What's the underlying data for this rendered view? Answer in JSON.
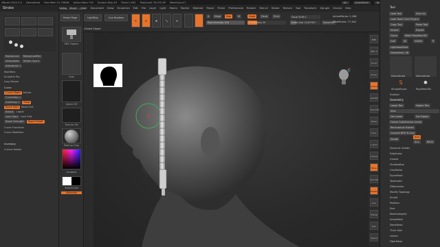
{
  "titlebar": {
    "app": "ZBrush 2022.0.5",
    "doc": "DemoHead",
    "free_mem": "Free Mem 21.758GB",
    "active_mem": "Active Mem 719",
    "scratch": "Scratch Disk 49",
    "timer": "Timer 0.001",
    "polycount": "PolyCount 76.072 KP",
    "meshcount": "MeshCount 2",
    "ac": "AC",
    "quicksave": "QuickSave",
    "seethrough": "See-through 0",
    "menus": "Menus",
    "default_script": "DefaultZScript"
  },
  "menubar": {
    "panel_title": "Stroke",
    "items": [
      "Alpha",
      "Brush",
      "Color",
      "Document",
      "Draw",
      "Dynamics",
      "Edit",
      "File",
      "Layer",
      "Light",
      "Macro",
      "Marker",
      "Material",
      "Movie",
      "Picker",
      "Preferences",
      "Render",
      "Stencil",
      "Stroke",
      "Texture",
      "Tool",
      "Transform",
      "Zplugin",
      "Zscript",
      "Help"
    ]
  },
  "leftpanel": {
    "replay_last": "ReplayLast",
    "replay_last_rel": "ReplayLastRel",
    "interpolate": "Interpolate",
    "stroke_count": "Stroke Count",
    "adjust_last": "AdjustLast 1",
    "modifiers": "Modifiers",
    "sculptris_pro": "Sculptris Pro",
    "lazy_mouse": "Lazy Mouse",
    "curve": "Curve",
    "curve_mode": "Curve Mode",
    "as_line": "AsLine",
    "curve_step": "CurveStep 1",
    "sub_steps": "SubSteps 1",
    "snap": "Snap",
    "bend_start": "Bend Start",
    "bend_end": "Bend End",
    "elastic": "Elastic",
    "liquid": "Liquid",
    "lock_start": "Lock Start",
    "lock_end": "Lock End",
    "repel_strength": "Repel Strength",
    "repel_falloff": "Repel Falloff",
    "curve_functions": "Curve Functions",
    "curve_modifiers": "Curve Modifiers",
    "inventory": "Inventory",
    "curves_helper": "Curves Helper"
  },
  "thumbcol": {
    "home_page": "Home Page",
    "zipper_label": "ZBS Zippers",
    "stroke_label": "Dots",
    "alpha_label": "Alpha Off",
    "texture_label": "Texture Off",
    "matcap_label": "MatCap Gray",
    "gradient": "Gradient",
    "switch_color": "SwitchColor",
    "alternate": "Alternate"
  },
  "toptool": {
    "home_page": "Home Page",
    "lightbox": "LightBox",
    "live_boolean": "Live Boolean",
    "closed_zipper": "Closed Zipper",
    "edit": "Edit",
    "draw": "Draw",
    "move": "Move",
    "scale": "Scale",
    "rotate": "Rotate",
    "a_label": "A",
    "mrgb": "Mrgb",
    "rgb": "Rgb",
    "m": "M",
    "zadd": "Zadd",
    "zsub": "Zsub",
    "zcut": "Zcut",
    "rgb_intensity": "Rgb Intensity 100",
    "z_intensity": "Z Intensity 25",
    "focal_shift": "Focal Shift 0",
    "draw_size": "Draw Size 14.87927",
    "dynamic": "Dynamic",
    "active_points": "ActivePoints: 2,168",
    "total_points": "TotalPoints: 77,342",
    "coords": "0.255 -0.315 -0.071"
  },
  "rightpanel": {
    "title": "Tool",
    "load_tool": "Load Tool",
    "save_as": "Save As",
    "load_tools_project": "Load Tools From Project",
    "copy_tool": "Copy Tool",
    "paste_tool": "Paste Tool",
    "import": "Import",
    "export": "Export",
    "clone": "Clone",
    "make_polymesh": "Make PolyMesh3D",
    "goz": "GoZ",
    "all": "All",
    "visible": "Visible",
    "r": "R",
    "lightbox_tools": "Lightbox▸Tools",
    "demohead": "DemoHead. 48",
    "tool1": "DemoHead",
    "tool2": "DemoHead",
    "tool3": "SimpleBrush",
    "tool4": "PolyMesh3D",
    "subtool": "Subtool",
    "geometry": "Geometry",
    "lower_res": "Lower Res",
    "higher_res": "Higher Res",
    "sdiv": "SDiv",
    "del_lower": "Del Lower",
    "del_higher": "Del Higher",
    "freeze_subdiv": "Freeze SubDivision Levels",
    "reconstruct_subdiv": "Reconstruct Subdiv",
    "convert_bpr": "Convert BPR To Geo",
    "divide": "Divide",
    "smt": "Smt",
    "suv": "Suv",
    "reuv": "ReUV",
    "dynamic_subdiv": "Dynamic Subdiv",
    "edgeloop": "EdgeLoop",
    "crease": "Crease",
    "shadowbox": "ShadowBox",
    "claypolish": "ClayPolish",
    "dynamesh": "DynaMesh",
    "tessimate": "Tessimate",
    "zremesher": "ZRemesher",
    "modify_topology": "Modify Topology",
    "sculpt": "Sculpt",
    "position": "Position",
    "size": "Size",
    "meshintegrity": "MeshIntegrity",
    "arraymesh": "ArrayMesh",
    "nanomesh": "NanoMesh",
    "thick_skin": "Thick Skin",
    "layers": "Layers",
    "fibermesh": "FiberMesh"
  },
  "righticons": [
    "BPR",
    "SPix 3",
    "Scroll",
    "Zoom",
    "Actual",
    "AAHalf",
    "Dynamic",
    "Persp",
    "Floor",
    "L.Sym",
    "Frame",
    "Move",
    "ZoomD",
    "Rotate",
    "Line Fill",
    "Transp",
    "Solo",
    "Xpose"
  ],
  "colors": {
    "accent": "#e8732a",
    "bg": "#2a2a2a",
    "panel": "#303030"
  }
}
